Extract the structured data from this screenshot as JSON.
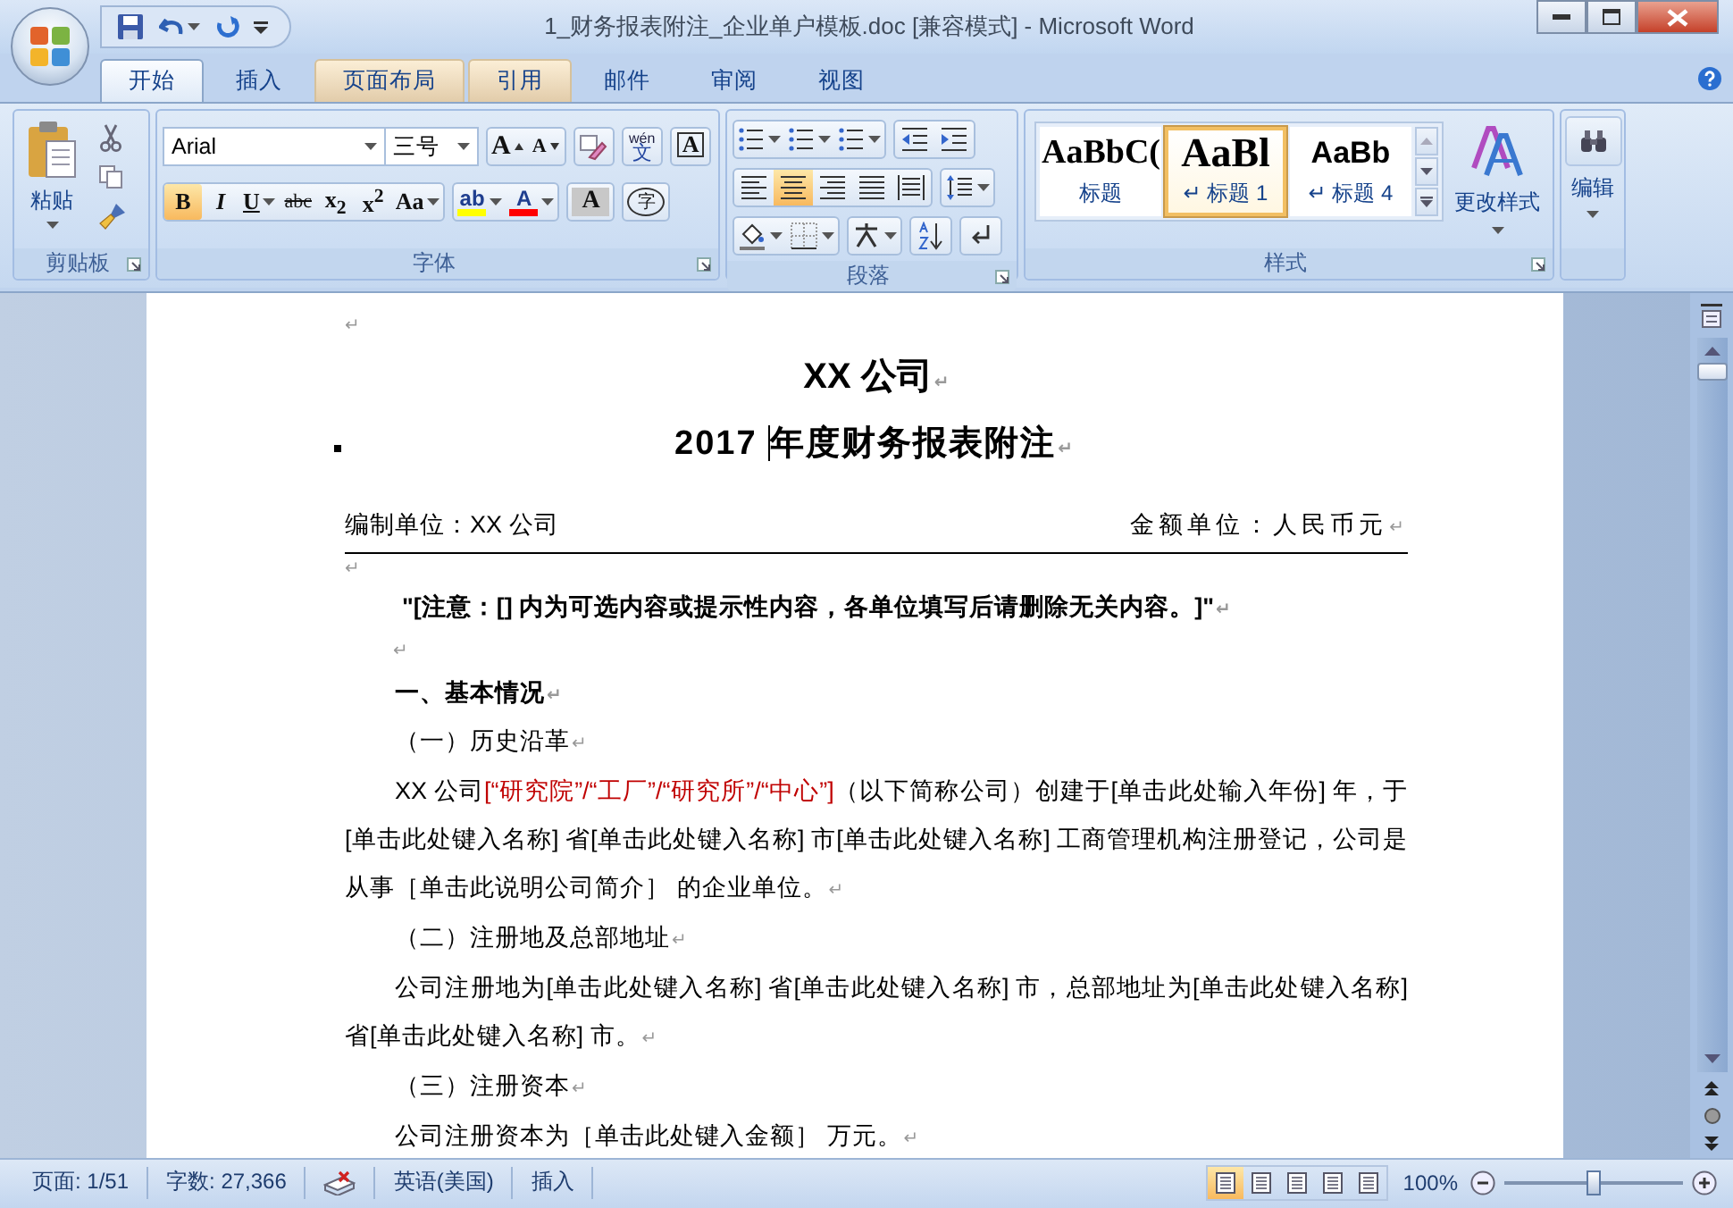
{
  "window": {
    "title": "1_财务报表附注_企业单户模板.doc [兼容模式] - Microsoft Word"
  },
  "tabs": [
    {
      "label": "开始",
      "selected": true,
      "highlighted": false
    },
    {
      "label": "插入",
      "selected": false,
      "highlighted": false
    },
    {
      "label": "页面布局",
      "selected": false,
      "highlighted": true
    },
    {
      "label": "引用",
      "selected": false,
      "highlighted": true
    },
    {
      "label": "邮件",
      "selected": false,
      "highlighted": false
    },
    {
      "label": "审阅",
      "selected": false,
      "highlighted": false
    },
    {
      "label": "视图",
      "selected": false,
      "highlighted": false
    }
  ],
  "ribbon": {
    "clipboard": {
      "label": "剪贴板",
      "paste": "粘贴"
    },
    "font": {
      "label": "字体",
      "font_name": "Arial",
      "font_size": "三号",
      "row_1": [
        {
          "kind": "grow",
          "text": "A"
        },
        {
          "kind": "shrink",
          "text": "A"
        },
        {
          "kind": "clear"
        },
        {
          "kind": "phonetic",
          "text": "wén",
          "text_2": "文"
        },
        {
          "kind": "border",
          "text": "A"
        }
      ],
      "row_2": [
        {
          "kind": "toggle",
          "text": "B",
          "selected": true,
          "dropdown": false
        },
        {
          "kind": "toggle",
          "text": "I",
          "selected": false,
          "dropdown": false
        },
        {
          "kind": "toggle",
          "text": "U",
          "selected": false,
          "dropdown": true
        },
        {
          "kind": "toggle",
          "text": "abc",
          "selected": false,
          "dropdown": false
        },
        {
          "kind": "toggle",
          "text": "x$_{2}$",
          "selected": false,
          "dropdown": false
        },
        {
          "kind": "toggle",
          "text": "x$^{2}$",
          "selected": false,
          "dropdown": false
        },
        {
          "kind": "toggle",
          "text": "Aa",
          "selected": false,
          "dropdown": true
        },
        {
          "kind": "color_pick",
          "text": "ab",
          "selected": false,
          "color": "#ffff00"
        },
        {
          "kind": "color_pick",
          "text": "A",
          "selected": false,
          "color": "#ff0000"
        },
        {
          "kind": "shading",
          "text": "A",
          "selected": false
        },
        {
          "kind": "enclose",
          "text": "字",
          "selected": false
        }
      ]
    },
    "paragraph": {
      "label": "段落",
      "align": [
        {
          "selected": false
        },
        {
          "selected": true
        },
        {
          "selected": false
        },
        {
          "selected": false
        },
        {
          "selected": false
        }
      ]
    },
    "styles": {
      "label": "样式",
      "change_styles": "更改样式",
      "gallery": [
        {
          "kind": "title",
          "sample": "AaBbC(",
          "name": "标题",
          "selected": false
        },
        {
          "kind": "heading_1",
          "sample": "AaBl",
          "name": "↵ 标题 1",
          "selected": true
        },
        {
          "kind": "heading_4",
          "sample": "AaBb",
          "name": "↵ 标题 4",
          "selected": false
        }
      ]
    },
    "editing": {
      "label": "编辑"
    }
  },
  "document": {
    "paragraphs": [
      {
        "kind": "empty",
        "mark": "↵"
      },
      {
        "kind": "title",
        "text": "XX 公司",
        "mark": "↵"
      },
      {
        "kind": "subtitle",
        "text": "2017 ",
        "text_after_caret": "年度财务报表附注",
        "mark": "↵",
        "keep_with_next": true
      },
      {
        "kind": "unit_row",
        "left": "编制单位：XX 公司",
        "right": "金额单位：人民币元",
        "mark": "↵"
      },
      {
        "kind": "empty",
        "mark": "↵"
      },
      {
        "kind": "note",
        "text": "\"[注意：[] 内为可选内容或提示性内容，各单位填写后请删除无关内容。]\"",
        "mark": "↵"
      },
      {
        "kind": "empty_indented",
        "mark": "↵"
      },
      {
        "kind": "heading",
        "text": "一、基本情况",
        "mark": "↵"
      },
      {
        "kind": "subheading",
        "text": "（一）历史沿革",
        "mark": "↵"
      },
      {
        "kind": "body",
        "mark": "↵",
        "segments": [
          {
            "text": "XX 公司",
            "red": false
          },
          {
            "text": "[“研究院”/“工厂”/“研究所”/“中心”]",
            "red": true
          },
          {
            "text": "（以下简称公司）创建于[单击此处输入年份] 年，于[单击此处键入名称] 省[单击此处键入名称] 市[单击此处键入名称] 工商管理机构注册登记，公司是从事［单击此说明公司简介］ 的企业单位。",
            "red": false
          }
        ]
      },
      {
        "kind": "subheading",
        "text": "（二）注册地及总部地址",
        "mark": "↵"
      },
      {
        "kind": "body",
        "mark": "↵",
        "segments": [
          {
            "text": "公司注册地为[单击此处键入名称] 省[单击此处键入名称] 市，总部地址为[单击此处键入名称] 省[单击此处键入名称] 市。",
            "red": false
          }
        ]
      },
      {
        "kind": "subheading",
        "text": "（三）注册资本",
        "mark": "↵"
      },
      {
        "kind": "body",
        "mark": "↵",
        "segments": [
          {
            "text": "公司注册资本为［单击此处键入金额］ 万元。",
            "red": false
          }
        ]
      }
    ]
  },
  "status_bar": {
    "items": [
      {
        "kind": "text",
        "text": "页面: 1/51"
      },
      {
        "kind": "text",
        "text": "字数: 27,366"
      },
      {
        "kind": "proofing"
      },
      {
        "kind": "text",
        "text": "英语(美国)"
      },
      {
        "kind": "text",
        "text": "插入"
      }
    ],
    "views": [
      {
        "selected": true
      },
      {
        "selected": false
      },
      {
        "selected": false
      },
      {
        "selected": false
      },
      {
        "selected": false
      }
    ],
    "zoom": {
      "reading": "100%",
      "level": 0.5
    }
  }
}
